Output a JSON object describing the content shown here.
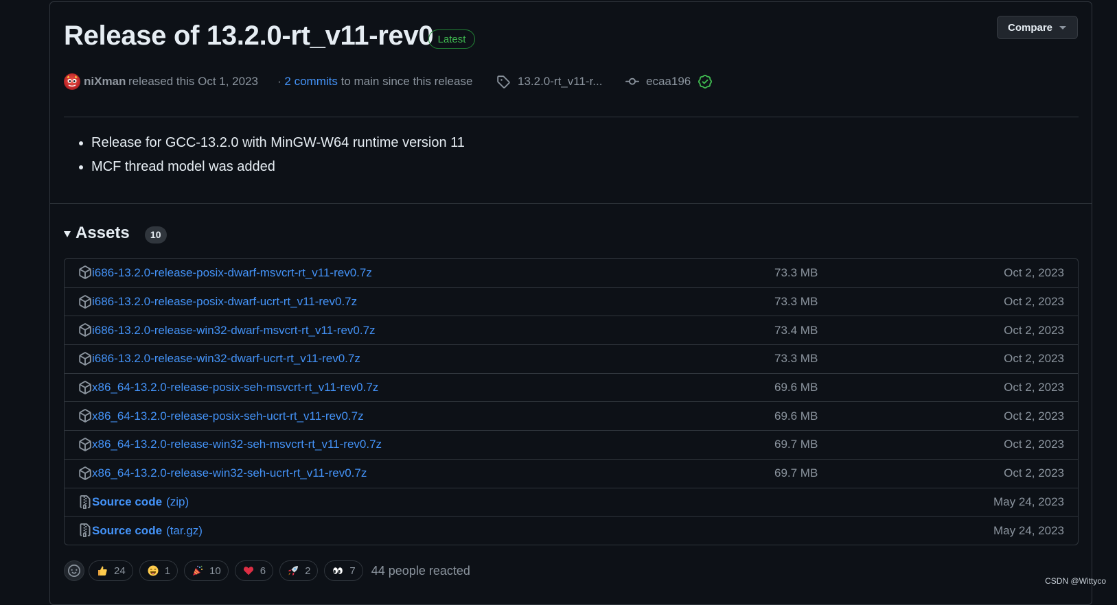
{
  "release": {
    "title": "Release of 13.2.0-rt_v11-rev0",
    "badge": "Latest",
    "compare_label": "Compare",
    "author": "niXman",
    "released_text": "released this Oct 1, 2023",
    "commits_prefix": "·",
    "commits_link": "2 commits",
    "commits_suffix": "to main since this release",
    "tag": "13.2.0-rt_v11-r...",
    "commit_hash": "ecaa196"
  },
  "notes": [
    "Release for GCC-13.2.0 with MinGW-W64 runtime version 11",
    "MCF thread model was added"
  ],
  "assets": {
    "title": "Assets",
    "count": "10",
    "items": [
      {
        "name": "i686-13.2.0-release-posix-dwarf-msvcrt-rt_v11-rev0.7z",
        "size": "73.3 MB",
        "date": "Oct 2, 2023"
      },
      {
        "name": "i686-13.2.0-release-posix-dwarf-ucrt-rt_v11-rev0.7z",
        "size": "73.3 MB",
        "date": "Oct 2, 2023"
      },
      {
        "name": "i686-13.2.0-release-win32-dwarf-msvcrt-rt_v11-rev0.7z",
        "size": "73.4 MB",
        "date": "Oct 2, 2023"
      },
      {
        "name": "i686-13.2.0-release-win32-dwarf-ucrt-rt_v11-rev0.7z",
        "size": "73.3 MB",
        "date": "Oct 2, 2023"
      },
      {
        "name": "x86_64-13.2.0-release-posix-seh-msvcrt-rt_v11-rev0.7z",
        "size": "69.6 MB",
        "date": "Oct 2, 2023"
      },
      {
        "name": "x86_64-13.2.0-release-posix-seh-ucrt-rt_v11-rev0.7z",
        "size": "69.6 MB",
        "date": "Oct 2, 2023"
      },
      {
        "name": "x86_64-13.2.0-release-win32-seh-msvcrt-rt_v11-rev0.7z",
        "size": "69.7 MB",
        "date": "Oct 2, 2023"
      },
      {
        "name": "x86_64-13.2.0-release-win32-seh-ucrt-rt_v11-rev0.7z",
        "size": "69.7 MB",
        "date": "Oct 2, 2023"
      }
    ],
    "source": [
      {
        "label": "Source code",
        "format": "(zip)",
        "date": "May 24, 2023"
      },
      {
        "label": "Source code",
        "format": "(tar.gz)",
        "date": "May 24, 2023"
      }
    ]
  },
  "reactions": {
    "items": [
      {
        "icon": "thumbs-up-icon",
        "count": "24"
      },
      {
        "icon": "laugh-icon",
        "count": "1"
      },
      {
        "icon": "hooray-icon",
        "count": "10"
      },
      {
        "icon": "heart-icon",
        "count": "6"
      },
      {
        "icon": "rocket-icon",
        "count": "2"
      },
      {
        "icon": "eyes-icon",
        "count": "7"
      }
    ],
    "summary": "44 people reacted"
  },
  "watermark": "CSDN @Wittyco",
  "colors": {
    "background": "#0d1117",
    "link": "#4493f8",
    "muted": "#8b949e",
    "border": "#30363d",
    "success": "#3fb950"
  }
}
